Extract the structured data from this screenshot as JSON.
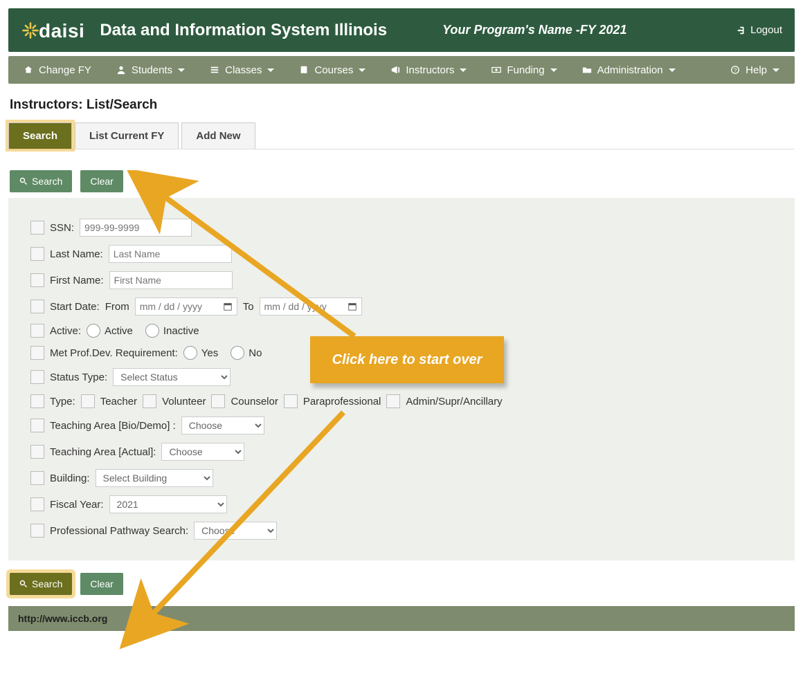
{
  "header": {
    "logo_text": "daisi",
    "title": "Data and Information System Illinois",
    "program_name": "Your Program's Name -FY 2021",
    "logout_label": "Logout"
  },
  "nav": {
    "change_fy": "Change FY",
    "students": "Students",
    "classes": "Classes",
    "courses": "Courses",
    "instructors": "Instructors",
    "funding": "Funding",
    "administration": "Administration",
    "help": "Help"
  },
  "page_heading": "Instructors: List/Search",
  "tabs": {
    "search": "Search",
    "list_current_fy": "List Current FY",
    "add_new": "Add New"
  },
  "buttons": {
    "search": "Search",
    "clear": "Clear"
  },
  "form": {
    "ssn_label": "SSN:",
    "ssn_placeholder": "999-99-9999",
    "last_name_label": "Last Name:",
    "last_name_placeholder": "Last Name",
    "first_name_label": "First Name:",
    "first_name_placeholder": "First Name",
    "start_date_label": "Start Date:",
    "from_label": "From",
    "to_label": "To",
    "date_placeholder": "mm / dd / yyyy",
    "active_label": "Active:",
    "active_option": "Active",
    "inactive_option": "Inactive",
    "met_pd_label": "Met Prof.Dev. Requirement:",
    "yes_label": "Yes",
    "no_label": "No",
    "status_type_label": "Status Type:",
    "status_select": "Select Status",
    "type_label": "Type:",
    "teacher_label": "Teacher",
    "volunteer_label": "Volunteer",
    "counselor_label": "Counselor",
    "paraprofessional_label": "Paraprofessional",
    "admin_label": "Admin/Supr/Ancillary",
    "teach_bio_label": "Teaching Area [Bio/Demo] :",
    "teach_actual_label": "Teaching Area [Actual]:",
    "choose_label": "Choose",
    "building_label": "Building:",
    "building_select": "Select Building",
    "fy_label": "Fiscal Year:",
    "fy_value": "2021",
    "pp_label": "Professional Pathway Search:"
  },
  "callout": {
    "text": "Click here to start over"
  },
  "footer": {
    "url": "http://www.iccb.org"
  }
}
